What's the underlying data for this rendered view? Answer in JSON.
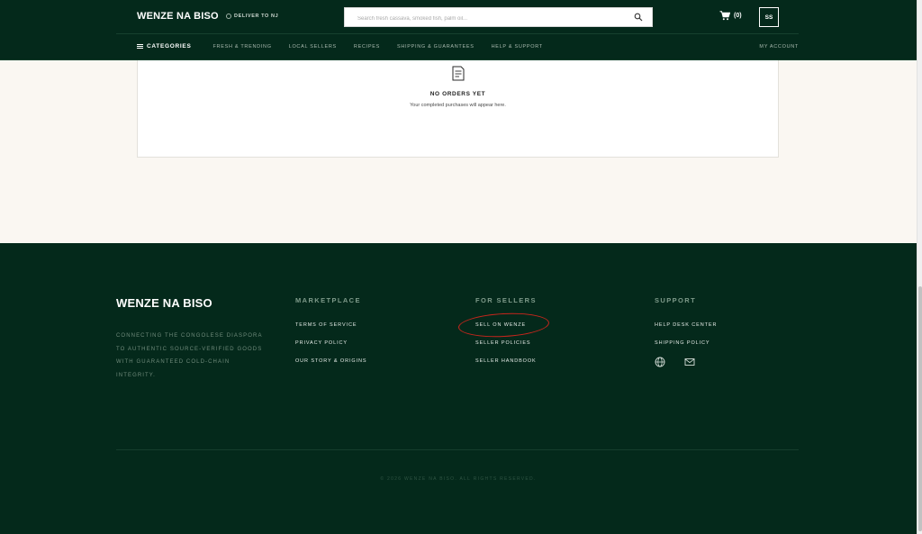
{
  "header": {
    "logo": "WENZE NA BISO",
    "deliver": "DELIVER TO NJ",
    "search_placeholder": "Search fresh cassava, smoked fish, palm oil...",
    "cart_count": "(0)",
    "avatar_initials": "SS",
    "categories_label": "CATEGORIES",
    "nav_links": [
      "FRESH & TRENDING",
      "LOCAL SELLERS",
      "RECIPES",
      "SHIPPING & GUARANTEES",
      "HELP & SUPPORT"
    ],
    "my_account": "MY ACCOUNT"
  },
  "orders": {
    "empty_title": "NO ORDERS YET",
    "empty_subtitle": "Your completed purchases will appear here."
  },
  "footer": {
    "brand": "WENZE NA BISO",
    "tagline": "CONNECTING THE CONGOLESE DIASPORA TO AUTHENTIC SOURCE-VERIFIED GOODS WITH GUARANTEED COLD-CHAIN INTEGRITY.",
    "marketplace": {
      "title": "MARKETPLACE",
      "links": [
        "TERMS OF SERVICE",
        "PRIVACY POLICY",
        "OUR STORY & ORIGINS"
      ]
    },
    "sellers": {
      "title": "FOR SELLERS",
      "links": [
        "SELL ON WENZE",
        "SELLER POLICIES",
        "SELLER HANDBOOK"
      ]
    },
    "support": {
      "title": "SUPPORT",
      "links": [
        "HELP DESK CENTER",
        "SHIPPING POLICY"
      ],
      "icons": [
        "globe-icon",
        "mail-icon"
      ]
    },
    "copyright": "© 2026 WENZE NA BISO. ALL RIGHTS RESERVED."
  },
  "colors": {
    "brand_dark_green": "#04291b",
    "page_background": "#faf7f2",
    "annotation_red": "#c9261c"
  }
}
